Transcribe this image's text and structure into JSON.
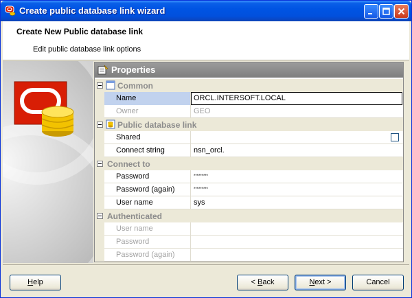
{
  "window": {
    "title": "Create public database link wizard"
  },
  "header": {
    "title": "Create New Public database link",
    "subtitle": "Edit public database link options"
  },
  "properties": {
    "title": "Properties",
    "categories": [
      {
        "label": "Common",
        "icon": "common-icon",
        "rows": [
          {
            "name": "Name",
            "value": "ORCL.INTERSOFT.LOCAL",
            "selected": true,
            "editing": true,
            "disabled": false
          },
          {
            "name": "Owner",
            "value": "GEO",
            "disabled": true
          }
        ]
      },
      {
        "label": "Public database link",
        "icon": "database-link-icon",
        "rows": [
          {
            "name": "Shared",
            "value": "",
            "checkbox": true,
            "checked": false
          },
          {
            "name": "Connect string",
            "value": "nsn_orcl."
          }
        ]
      },
      {
        "label": "Connect to",
        "rows": [
          {
            "name": "Password",
            "value": "*********",
            "password": true
          },
          {
            "name": "Password (again)",
            "value": "*********",
            "password": true
          },
          {
            "name": "User name",
            "value": "sys"
          }
        ]
      },
      {
        "label": "Authenticated",
        "rows": [
          {
            "name": "User name",
            "value": "",
            "disabled": true
          },
          {
            "name": "Password",
            "value": "",
            "disabled": true
          },
          {
            "name": "Password (again)",
            "value": "",
            "disabled": true
          }
        ]
      }
    ]
  },
  "buttons": {
    "help": {
      "prefix": "",
      "mnemonic": "H",
      "suffix": "elp"
    },
    "back": {
      "prefix": "< ",
      "mnemonic": "B",
      "suffix": "ack"
    },
    "next": {
      "prefix": "",
      "mnemonic": "N",
      "suffix": "ext >"
    },
    "cancel": {
      "label": "Cancel"
    }
  },
  "colors": {
    "titlebar": "#0054e3",
    "selection": "#c1d2ee",
    "oracle_red": "#d81e05",
    "db_gold": "#f2c200"
  }
}
